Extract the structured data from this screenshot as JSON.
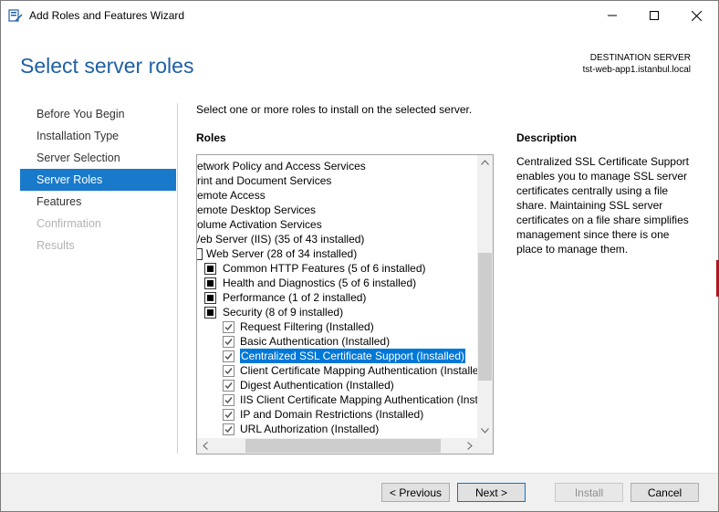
{
  "window": {
    "title": "Add Roles and Features Wizard",
    "controls": {
      "minimize": "minimize-icon",
      "maximize": "maximize-icon",
      "close": "close-icon"
    }
  },
  "header": {
    "title": "Select server roles",
    "destination_label": "DESTINATION SERVER",
    "destination_server": "tst-web-app1.istanbul.local"
  },
  "nav": {
    "items": [
      {
        "label": "Before You Begin",
        "state": "normal"
      },
      {
        "label": "Installation Type",
        "state": "normal"
      },
      {
        "label": "Server Selection",
        "state": "normal"
      },
      {
        "label": "Server Roles",
        "state": "active"
      },
      {
        "label": "Features",
        "state": "normal"
      },
      {
        "label": "Confirmation",
        "state": "disabled"
      },
      {
        "label": "Results",
        "state": "disabled"
      }
    ]
  },
  "main": {
    "instruction": "Select one or more roles to install on the selected server.",
    "roles_label": "Roles",
    "roles": [
      {
        "label": "etwork Policy and Access Services",
        "control": "none"
      },
      {
        "label": "rint and Document Services",
        "control": "none"
      },
      {
        "label": "emote Access",
        "control": "none"
      },
      {
        "label": "emote Desktop Services",
        "control": "none"
      },
      {
        "label": "olume Activation Services",
        "control": "none"
      },
      {
        "label": "/eb Server (IIS) (35 of 43 installed)",
        "control": "none"
      },
      {
        "label": "Web Server (28 of 34 installed)",
        "control": "partial-edge"
      },
      {
        "label": "Common HTTP Features (5 of 6 installed)",
        "control": "partial"
      },
      {
        "label": "Health and Diagnostics (5 of 6 installed)",
        "control": "partial"
      },
      {
        "label": "Performance (1 of 2 installed)",
        "control": "partial"
      },
      {
        "label": "Security (8 of 9 installed)",
        "control": "partial"
      },
      {
        "label": "Request Filtering (Installed)",
        "control": "checked"
      },
      {
        "label": "Basic Authentication (Installed)",
        "control": "checked"
      },
      {
        "label": "Centralized SSL Certificate Support (Installed)",
        "control": "checked",
        "selected": true
      },
      {
        "label": "Client Certificate Mapping Authentication (Installe",
        "control": "checked"
      },
      {
        "label": "Digest Authentication (Installed)",
        "control": "checked"
      },
      {
        "label": "IIS Client Certificate Mapping Authentication (Inst",
        "control": "checked"
      },
      {
        "label": "IP and Domain Restrictions (Installed)",
        "control": "checked"
      },
      {
        "label": "URL Authorization (Installed)",
        "control": "checked"
      }
    ]
  },
  "description": {
    "label": "Description",
    "text": "Centralized SSL Certificate Support enables you to manage SSL server certificates centrally using a file share. Maintaining SSL server certificates on a file share simplifies management since there is one place to manage them."
  },
  "footer": {
    "previous": "< Previous",
    "next": "Next >",
    "install": "Install",
    "cancel": "Cancel"
  },
  "colors": {
    "accent": "#1979ca",
    "title_blue": "#1e5fa6",
    "selection": "#0078d7"
  }
}
